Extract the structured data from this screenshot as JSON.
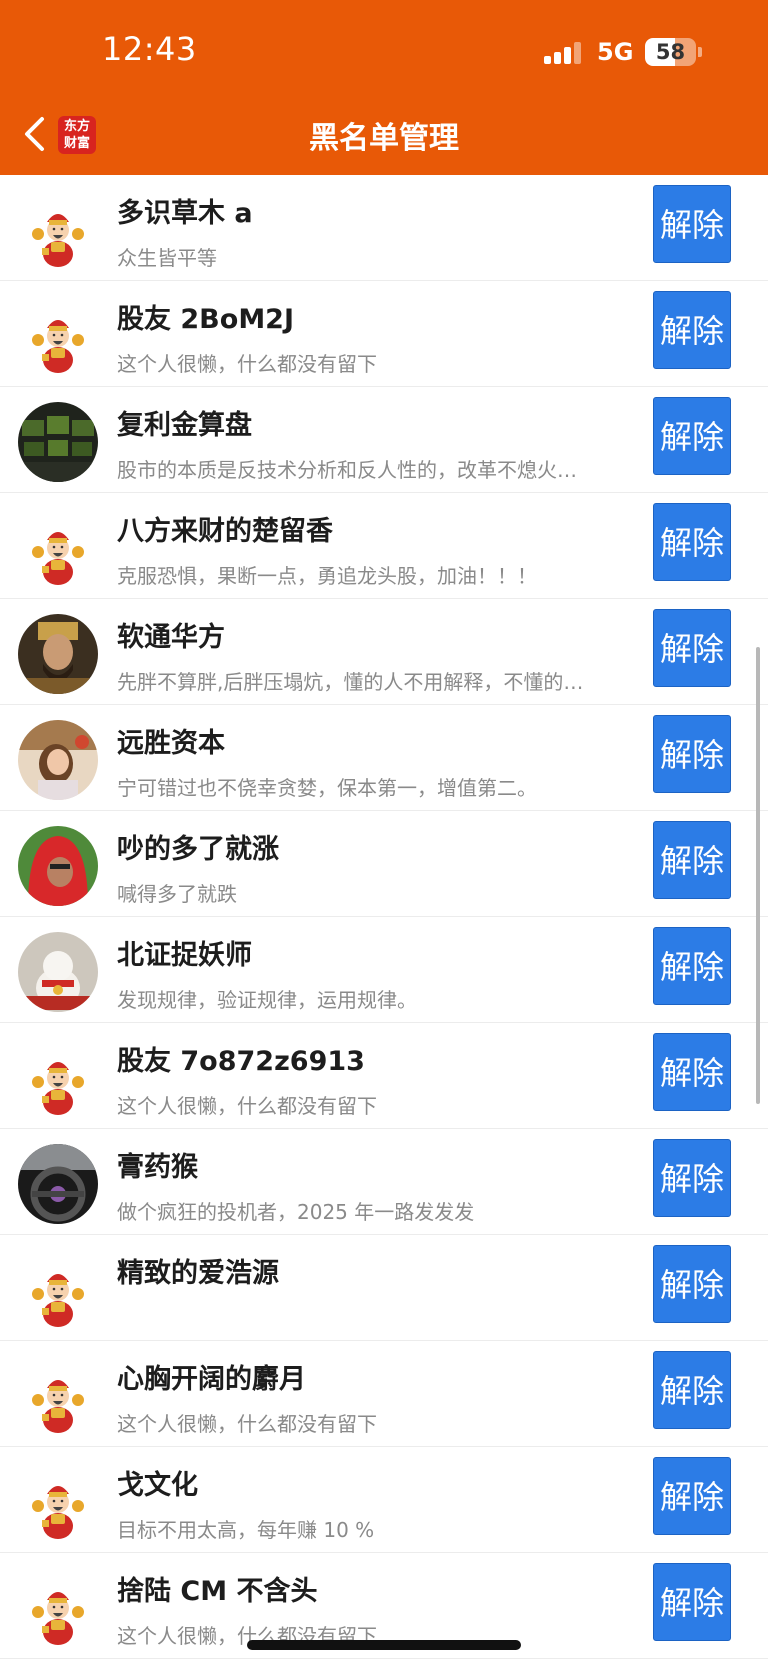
{
  "status_bar": {
    "time": "12:43",
    "network": "5G",
    "battery": "58",
    "battery_level": 0.58
  },
  "header": {
    "title": "黑名单管理",
    "logo_text": "东方财富",
    "brand_color": "#e85907"
  },
  "button_color": "#2c7ce6",
  "items": [
    {
      "name": "多识草木 a",
      "signature": "众生皆平等",
      "avatar": "caishen",
      "button": "解除"
    },
    {
      "name": "股友 2BoM2J",
      "signature": "这个人很懒，什么都没有留下",
      "avatar": "caishen",
      "button": "解除"
    },
    {
      "name": "复利金算盘",
      "signature": "股市的本质是反技术分析和反人性的，改革不熄火…",
      "avatar": "trading-screens-photo",
      "button": "解除"
    },
    {
      "name": "八方来财的楚留香",
      "signature": "克服恐惧，果断一点，勇追龙头股，加油！！！",
      "avatar": "caishen",
      "button": "解除"
    },
    {
      "name": "软通华方",
      "signature": "先胖不算胖,后胖压塌炕，懂的人不用解释，不懂的…",
      "avatar": "emperor-portrait-photo",
      "button": "解除"
    },
    {
      "name": "远胜资本",
      "signature": "宁可错过也不侥幸贪婪，保本第一，增值第二。",
      "avatar": "woman-portrait-photo",
      "button": "解除"
    },
    {
      "name": "吵的多了就涨",
      "signature": "喊得多了就跌",
      "avatar": "red-hood-person-photo",
      "button": "解除"
    },
    {
      "name": "北证捉妖师",
      "signature": "发现规律，验证规律，运用规律。",
      "avatar": "lucky-cat-photo",
      "button": "解除"
    },
    {
      "name": "股友 7o872z6913",
      "signature": "这个人很懒，什么都没有留下",
      "avatar": "caishen",
      "button": "解除"
    },
    {
      "name": "膏药猴",
      "signature": "做个疯狂的投机者，2025 年一路发发发",
      "avatar": "car-steering-wheel-photo",
      "button": "解除"
    },
    {
      "name": "精致的爱浩源",
      "signature": "",
      "avatar": "caishen",
      "button": "解除"
    },
    {
      "name": "心胸开阔的麝月",
      "signature": "这个人很懒，什么都没有留下",
      "avatar": "caishen",
      "button": "解除"
    },
    {
      "name": "戈文化",
      "signature": "目标不用太高，每年赚 10 %",
      "avatar": "caishen",
      "button": "解除"
    },
    {
      "name": "捨陆 CM 不含头",
      "signature": "这个人很懒，什么都没有留下",
      "avatar": "caishen",
      "button": "解除"
    }
  ]
}
